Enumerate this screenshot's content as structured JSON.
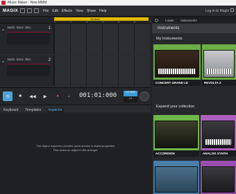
{
  "window": {
    "title": "Music Maker - New.MMM"
  },
  "menubar": {
    "logo": "MAGIX",
    "items": [
      "File",
      "Edit",
      "Effects",
      "View",
      "Share",
      "Help"
    ],
    "login": "Log in to Magix"
  },
  "arranger": {
    "ruler_label": "16 Bars",
    "ticks": [
      "1",
      "2",
      "3",
      "4",
      "5",
      "6",
      "7"
    ],
    "tracks": [
      {
        "number": "1",
        "buttons": [
          "MUTE",
          "SOLO",
          "REC"
        ]
      },
      {
        "number": "2",
        "buttons": [
          "MUTE",
          "SOLO",
          "REC"
        ]
      }
    ]
  },
  "transport": {
    "time": "001:01:000",
    "bpm": "120 BPM",
    "signature": "4/4"
  },
  "bottom": {
    "tabs": [
      "Keyboard",
      "Templates",
      "Inspector"
    ],
    "active_tab": "Inspector",
    "message_line1": "The Object Inspector provides quick access to object properties.",
    "message_line2": "First select an object in the arranger."
  },
  "right": {
    "tabs": [
      "Loops",
      "Instruments"
    ],
    "header": "Instruments",
    "my_instruments_label": "My Instruments",
    "expand_label": "Expand your collection",
    "my_instruments": [
      {
        "name": "CONCERT GRAND LE",
        "art": "piano"
      },
      {
        "name": "REVOLTA 2",
        "art": "synth"
      }
    ],
    "expand": [
      {
        "name": "ACCORDION",
        "art": "acc",
        "tint": "#6fb74a"
      },
      {
        "name": "ANALOG SYNTH",
        "art": "analog",
        "tint": "#b05fbf"
      },
      {
        "name": "",
        "art": "blue",
        "tint": "#4a7ea8"
      },
      {
        "name": "",
        "art": "analog",
        "tint": "#9a4fb0"
      }
    ]
  }
}
